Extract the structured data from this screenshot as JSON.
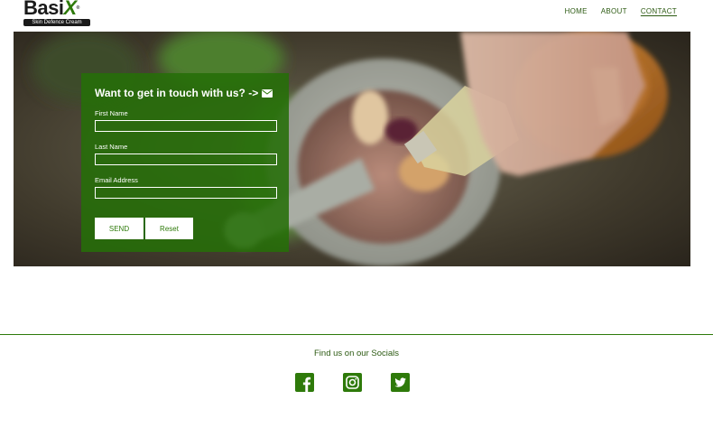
{
  "brand": {
    "logo_text": "Basi",
    "logo_x": "X",
    "logo_mark": "®",
    "tagline": "Skin Defence Cream",
    "accent": "#2e7a0a"
  },
  "nav": {
    "items": [
      {
        "label": "HOME"
      },
      {
        "label": "ABOUT"
      },
      {
        "label": "CONTACT",
        "active": true
      }
    ]
  },
  "hero": {
    "image": "mortar-and-pestle-with-oil-bottle"
  },
  "contact_form": {
    "title": "Want to get in touch with us? ->",
    "title_icon": "envelope-icon",
    "first_name_label": "First Name",
    "first_name_value": "",
    "last_name_label": "Last Name",
    "last_name_value": "",
    "email_label": "Email Address",
    "email_value": "",
    "send_label": "SEND",
    "reset_label": "Reset"
  },
  "footer": {
    "socials_text": "Find us on our Socials",
    "socials": [
      {
        "icon": "facebook-icon"
      },
      {
        "icon": "instagram-icon"
      },
      {
        "icon": "twitter-icon"
      }
    ]
  }
}
